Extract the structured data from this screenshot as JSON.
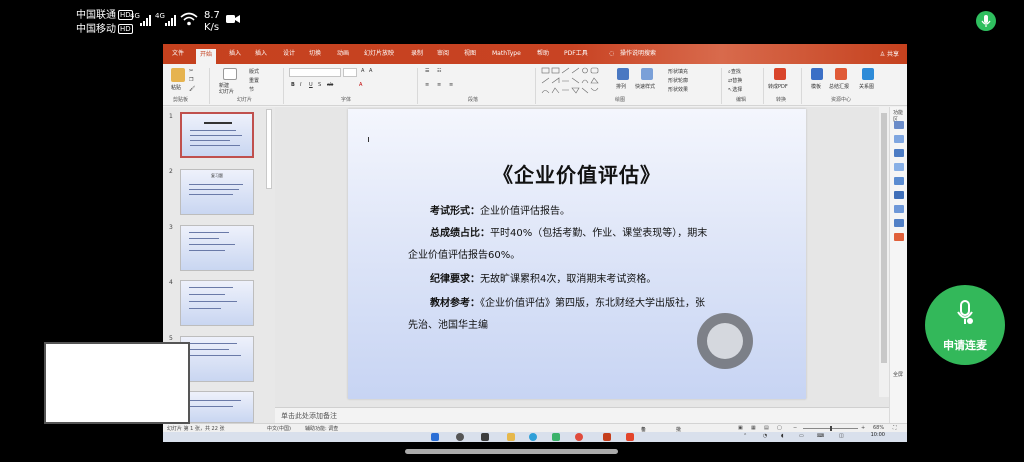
{
  "status_bar": {
    "carrier1": "中国联通",
    "carrier2": "中国移动",
    "hd": "HD",
    "network1": "4G",
    "network2": "4G",
    "speed_value": "8.7",
    "speed_unit": "K/s"
  },
  "ppt": {
    "tabs": [
      "文件",
      "开始",
      "插入",
      "设计",
      "切换",
      "动画",
      "幻灯片放映",
      "录制",
      "审阅",
      "视图",
      "MathType",
      "帮助",
      "PDF工具",
      "操作说明搜索"
    ],
    "active_tab": "开始",
    "tab_insert_label": "插入",
    "share_label": "共享",
    "ribbon": {
      "paste": "粘贴",
      "new_slide": "新建\n幻灯片",
      "layout": "版式",
      "reset": "重置",
      "section": "节",
      "arrange": "排列",
      "quick_styles": "快速样式",
      "shape_fill": "形状填充",
      "shape_outline": "形状轮廓",
      "shape_effect": "形状效果",
      "find": "查找",
      "replace": "替换",
      "select": "选择",
      "convert_pdf": "转成PDF",
      "template": "模板",
      "summary": "总结汇报",
      "relation": "关系图",
      "groups": {
        "clipboard": "剪贴板",
        "slides": "幻灯片",
        "font": "字体",
        "paragraph": "段落",
        "drawing": "绘图",
        "editing": "编辑",
        "convert": "转换",
        "resources": "资源中心"
      }
    },
    "slide_numbers": [
      "1",
      "2",
      "3",
      "4",
      "5"
    ],
    "thumb2_title": "复习题",
    "slide": {
      "title": "《企业价值评估》",
      "lines": [
        {
          "label": "考试形式：",
          "text": "企业价值评估报告。"
        },
        {
          "label": "总成绩占比：",
          "text": "平时40%（包括考勤、作业、课堂表现等），期末"
        },
        {
          "label": "",
          "text": "企业价值评估报告60%。"
        },
        {
          "label": "纪律要求：",
          "text": "无故旷课累积4次，取消期末考试资格。"
        },
        {
          "label": "教材参考：",
          "text": "《企业价值评估》第四版，东北财经大学出版社，张"
        },
        {
          "label": "",
          "text": "先治、池国华主编"
        }
      ]
    },
    "notes_placeholder": "单击此处添加备注",
    "status": {
      "slide_counter": "幻灯片 第 1 张，共 22 张",
      "language": "中文(中国)",
      "accessibility": "辅助功能: 调查",
      "notes": "备注",
      "comments": "批注",
      "zoom": "68%"
    },
    "right_panel": {
      "top": "功能区",
      "bottom": "全屏"
    },
    "clock": "10:00"
  },
  "apply_button_label": "申请连麦",
  "colors": {
    "ppt_accent": "#c43e1c",
    "apply_green": "#33b85a"
  }
}
